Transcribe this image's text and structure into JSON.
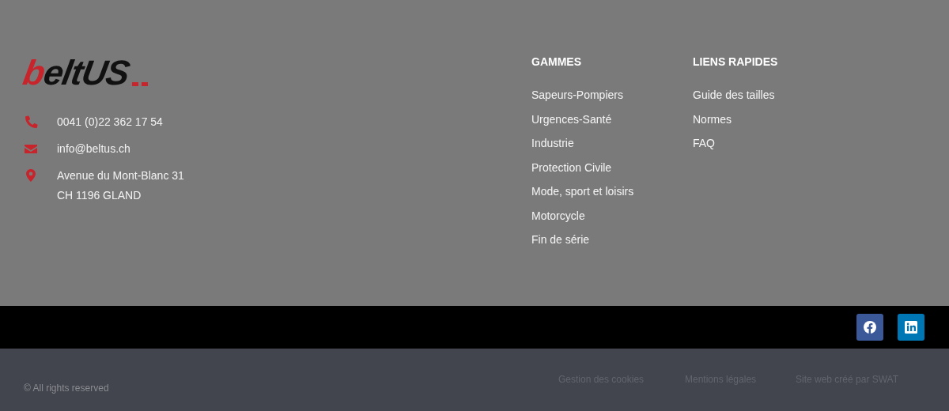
{
  "logo": {
    "text": "beltUS"
  },
  "contact": [
    {
      "kind": "phone",
      "lines": [
        "0041 (0)22 362 17 54"
      ]
    },
    {
      "kind": "email",
      "lines": [
        "info@beltus.ch"
      ]
    },
    {
      "kind": "address",
      "lines": [
        "Avenue du Mont-Blanc 31",
        "CH 1196 GLAND"
      ]
    }
  ],
  "menus": [
    {
      "title": "GAMMES",
      "items": [
        "Sapeurs-Pompiers",
        "Urgences-Santé",
        "Industrie",
        "Protection Civile",
        "Mode, sport et loisirs",
        "Motorcycle",
        "Fin de série"
      ]
    },
    {
      "title": "LIENS RAPIDES",
      "items": [
        "Guide des tailles",
        "Normes",
        "FAQ"
      ]
    }
  ],
  "social": [
    {
      "kind": "facebook",
      "color": "#3b5998"
    },
    {
      "kind": "linkedin",
      "color": "#0077b5"
    }
  ],
  "copyright": "© All rights reserved",
  "legal_links": [
    "Gestion des cookies",
    "Mentions légales",
    "Site web créé par SWAT"
  ]
}
